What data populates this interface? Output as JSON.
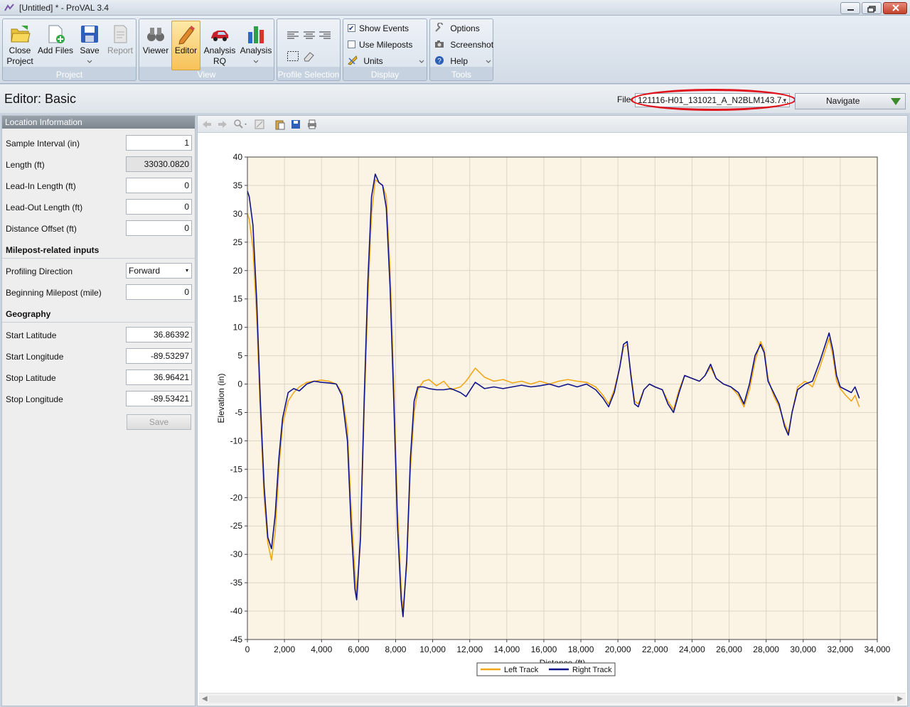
{
  "window": {
    "title": "[Untitled] * - ProVAL 3.4"
  },
  "ribbon": {
    "project": {
      "label": "Project",
      "close_l1": "Close",
      "close_l2": "Project",
      "add_files": "Add Files",
      "save": "Save",
      "report": "Report"
    },
    "view": {
      "label": "View",
      "viewer": "Viewer",
      "editor": "Editor",
      "analysis_rq_l1": "Analysis",
      "analysis_rq_l2": "RQ",
      "analysis": "Analysis"
    },
    "profile_selection": {
      "label": "Profile Selection"
    },
    "display": {
      "label": "Display",
      "show_events": "Show Events",
      "show_events_checked": true,
      "use_mileposts": "Use Mileposts",
      "use_mileposts_checked": false,
      "units": "Units"
    },
    "tools": {
      "label": "Tools",
      "options": "Options",
      "screenshot": "Screenshot",
      "help": "Help"
    }
  },
  "editor": {
    "title": "Editor: Basic",
    "file_label": "File",
    "file_value": "121116-H01_131021_A_N2BLM143.7...",
    "navigate": "Navigate"
  },
  "location": {
    "header": "Location Information",
    "sample_interval": {
      "label": "Sample Interval (in)",
      "value": "1"
    },
    "length": {
      "label": "Length (ft)",
      "value": "33030.0820"
    },
    "lead_in": {
      "label": "Lead-In Length (ft)",
      "value": "0"
    },
    "lead_out": {
      "label": "Lead-Out Length (ft)",
      "value": "0"
    },
    "distance_offset": {
      "label": "Distance Offset (ft)",
      "value": "0"
    },
    "milepost_section": "Milepost-related inputs",
    "profiling_direction": {
      "label": "Profiling Direction",
      "value": "Forward"
    },
    "beginning_milepost": {
      "label": "Beginning Milepost (mile)",
      "value": "0"
    },
    "geography_section": "Geography",
    "start_latitude": {
      "label": "Start Latitude",
      "value": "36.86392"
    },
    "start_longitude": {
      "label": "Start Longitude",
      "value": "-89.53297"
    },
    "stop_latitude": {
      "label": "Stop Latitude",
      "value": "36.96421"
    },
    "stop_longitude": {
      "label": "Stop Longitude",
      "value": "-89.53421"
    },
    "save": "Save"
  },
  "colors": {
    "left_track": "#f0a818",
    "right_track": "#10148a",
    "plot_bg": "#fbf3e3",
    "grid": "#ddd6c8"
  },
  "chart_data": {
    "type": "line",
    "xlabel": "Distance (ft)",
    "ylabel": "Elevation (in)",
    "xlim": [
      0,
      34000
    ],
    "ylim": [
      -45,
      40
    ],
    "xticks": [
      0,
      2000,
      4000,
      6000,
      8000,
      10000,
      12000,
      14000,
      16000,
      18000,
      20000,
      22000,
      24000,
      26000,
      28000,
      30000,
      32000,
      34000
    ],
    "xtick_labels": [
      "0",
      "2,000",
      "4,000",
      "6,000",
      "8,000",
      "10,000",
      "12,000",
      "14,000",
      "16,000",
      "18,000",
      "20,000",
      "22,000",
      "24,000",
      "26,000",
      "28,000",
      "30,000",
      "32,000",
      "34,000"
    ],
    "yticks": [
      40,
      35,
      30,
      25,
      20,
      15,
      10,
      5,
      0,
      -5,
      -10,
      -15,
      -20,
      -25,
      -30,
      -35,
      -40,
      -45
    ],
    "grid": true,
    "legend": "bottom-center",
    "series": [
      {
        "name": "Left Track",
        "x": [
          0,
          100,
          300,
          500,
          700,
          900,
          1100,
          1300,
          1500,
          1700,
          1900,
          2200,
          2500,
          2800,
          3200,
          3600,
          4000,
          4400,
          4800,
          5100,
          5400,
          5600,
          5800,
          5900,
          6100,
          6300,
          6500,
          6700,
          6900,
          7100,
          7300,
          7500,
          7700,
          7900,
          8100,
          8300,
          8400,
          8600,
          8800,
          9000,
          9200,
          9500,
          9800,
          10200,
          10600,
          11000,
          11500,
          11800,
          12300,
          12800,
          13300,
          13800,
          14300,
          14800,
          15300,
          15800,
          16300,
          16800,
          17300,
          17800,
          18300,
          18800,
          19200,
          19500,
          19800,
          20100,
          20300,
          20500,
          20700,
          20900,
          21100,
          21400,
          21700,
          22000,
          22400,
          22700,
          23000,
          23300,
          23600,
          24000,
          24400,
          24700,
          25000,
          25300,
          25700,
          26100,
          26500,
          26800,
          27100,
          27400,
          27700,
          27900,
          28100,
          28400,
          28700,
          29000,
          29200,
          29400,
          29700,
          30100,
          30500,
          30900,
          31200,
          31400,
          31600,
          31800,
          32000,
          32300,
          32600,
          32800,
          33030
        ],
        "y": [
          30,
          29,
          24,
          12,
          -5,
          -20,
          -28,
          -31,
          -26,
          -15,
          -7,
          -3,
          -1.5,
          -0.5,
          0.3,
          0.5,
          0.7,
          0.5,
          0,
          -1.5,
          -8,
          -22,
          -33,
          -37,
          -28,
          -5,
          15,
          30,
          36,
          35.5,
          35,
          33,
          20,
          0,
          -22,
          -36,
          -40,
          -32,
          -15,
          -5,
          -1,
          0.5,
          0.8,
          -0.3,
          0.5,
          -1,
          -0.5,
          0.5,
          2.8,
          1.2,
          0.5,
          0.8,
          0.2,
          0.5,
          0,
          0.5,
          0,
          0.5,
          0.8,
          0.5,
          0.3,
          -0.5,
          -2,
          -3.5,
          -1,
          3,
          6.5,
          7,
          2,
          -3,
          -3.5,
          -1,
          0,
          -0.5,
          -1,
          -3,
          -4.5,
          -1,
          1.5,
          1,
          0.5,
          1.5,
          3,
          1,
          0,
          -0.5,
          -2,
          -4,
          -1,
          4,
          7.5,
          6,
          1,
          -2,
          -4,
          -7,
          -8.5,
          -5,
          -0.5,
          0.5,
          -0.5,
          3,
          6,
          8,
          5,
          0.5,
          -0.8,
          -2,
          -3,
          -2,
          -4
        ]
      },
      {
        "name": "Right Track",
        "x": [
          0,
          100,
          300,
          500,
          700,
          900,
          1100,
          1300,
          1500,
          1700,
          1900,
          2200,
          2500,
          2800,
          3200,
          3600,
          4000,
          4400,
          4800,
          5100,
          5400,
          5600,
          5800,
          5900,
          6100,
          6300,
          6500,
          6700,
          6900,
          7100,
          7300,
          7500,
          7700,
          7900,
          8100,
          8300,
          8400,
          8600,
          8800,
          9000,
          9200,
          9500,
          9800,
          10200,
          10600,
          11000,
          11500,
          11800,
          12300,
          12800,
          13300,
          13800,
          14300,
          14800,
          15300,
          15800,
          16300,
          16800,
          17300,
          17800,
          18300,
          18800,
          19200,
          19500,
          19800,
          20100,
          20300,
          20500,
          20700,
          20900,
          21100,
          21400,
          21700,
          22000,
          22400,
          22700,
          23000,
          23300,
          23600,
          24000,
          24400,
          24700,
          25000,
          25300,
          25700,
          26100,
          26500,
          26800,
          27100,
          27400,
          27700,
          27900,
          28100,
          28400,
          28700,
          29000,
          29200,
          29400,
          29700,
          30100,
          30500,
          30900,
          31200,
          31400,
          31600,
          31800,
          32000,
          32300,
          32600,
          32800,
          33030
        ],
        "y": [
          34,
          33,
          28,
          15,
          -3,
          -18,
          -27,
          -29,
          -23,
          -13,
          -6,
          -1.5,
          -0.8,
          -1.2,
          0,
          0.5,
          0.3,
          0.2,
          0,
          -2,
          -10,
          -25,
          -36,
          -38,
          -27,
          -3,
          18,
          33,
          37,
          35.5,
          35,
          31,
          17,
          -3,
          -25,
          -38,
          -41,
          -31,
          -13,
          -3,
          -0.5,
          -0.5,
          -0.8,
          -1,
          -1,
          -0.8,
          -1.5,
          -2.2,
          0.3,
          -0.8,
          -0.5,
          -0.8,
          -0.5,
          -0.2,
          -0.5,
          -0.3,
          0,
          -0.5,
          0,
          -0.5,
          0,
          -1,
          -2.5,
          -4,
          -1.5,
          3,
          7,
          7.5,
          1.5,
          -3.5,
          -4,
          -1,
          0,
          -0.5,
          -1,
          -3.5,
          -5,
          -1.5,
          1.5,
          1,
          0.5,
          1.5,
          3.5,
          1,
          0,
          -0.5,
          -1.5,
          -3.5,
          0,
          5,
          7,
          5.5,
          0.5,
          -1.5,
          -3.5,
          -7.5,
          -9,
          -5,
          -1,
          0,
          0.5,
          4,
          7,
          9,
          6,
          1.5,
          -0.5,
          -1,
          -1.5,
          -0.5,
          -2.5
        ]
      }
    ]
  }
}
